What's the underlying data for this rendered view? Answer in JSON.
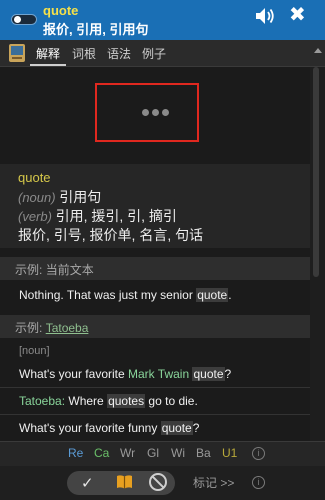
{
  "header": {
    "word": "quote",
    "meaning": "报价, 引用, 引用句",
    "speaker_icon": "speaker-icon",
    "close_label": "✖"
  },
  "tabs": [
    {
      "label": "解释",
      "active": true
    },
    {
      "label": "词根",
      "active": false
    },
    {
      "label": "语法",
      "active": false
    },
    {
      "label": "例子",
      "active": false
    }
  ],
  "definition": {
    "word": "quote",
    "noun_pos": "(noun)",
    "noun_meaning": "引用句",
    "verb_pos": "(verb)",
    "verb_meaning": "引用, 援引, 引, 摘引",
    "other_meaning": "报价, 引号, 报价单, 名言, 句话"
  },
  "example_current": {
    "label": "示例:",
    "source": "当前文本",
    "sentence_before": "Nothing. That was just my senior ",
    "sentence_hl": "quote",
    "sentence_after": "."
  },
  "example_tatoeba": {
    "label": "示例:",
    "source": "Tatoeba",
    "tag": "[noun]",
    "s1_a": "What's your favorite ",
    "s1_green": "Mark Twain",
    "s1_b": " ",
    "s1_hl": "quote",
    "s1_c": "?",
    "s2_prefix": "Tatoeba:",
    "s2_a": " Where ",
    "s2_hl": "quotes",
    "s2_b": " go to die.",
    "s3_a": "What's your favorite funny ",
    "s3_hl": "quote",
    "s3_b": "?"
  },
  "sources": [
    {
      "label": "Re",
      "color": "#5b9bd5"
    },
    {
      "label": "Ca",
      "color": "#6abf69"
    },
    {
      "label": "Wr",
      "color": "#9a9a9a"
    },
    {
      "label": "Gl",
      "color": "#9a9a9a"
    },
    {
      "label": "Wi",
      "color": "#9a9a9a"
    },
    {
      "label": "Ba",
      "color": "#9a9a9a"
    },
    {
      "label": "U1",
      "color": "#b8a93a"
    }
  ],
  "toolbar": {
    "check_label": "✓",
    "mark_label": "标记 >>"
  }
}
